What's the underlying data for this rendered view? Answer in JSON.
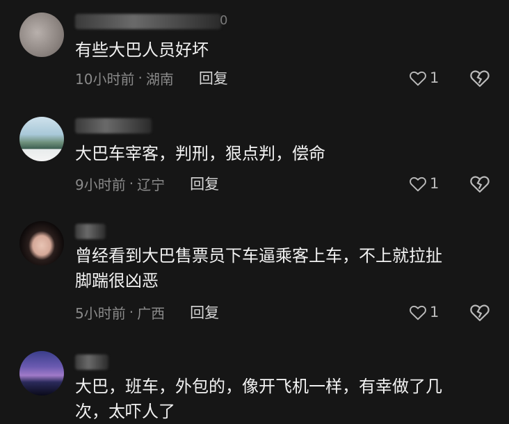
{
  "comments": [
    {
      "name_tail": "0",
      "text": "有些大巴人员好坏",
      "time": "10小时前",
      "separator": "·",
      "location": "湖南",
      "reply_label": "回复",
      "likes": "1"
    },
    {
      "name_tail": "",
      "text": "大巴车宰客，判刑，狠点判，偿命",
      "time": "9小时前",
      "separator": "·",
      "location": "辽宁",
      "reply_label": "回复",
      "likes": "1"
    },
    {
      "name_tail": "",
      "text": "曾经看到大巴售票员下车逼乘客上车，不上就拉扯\n脚踹很凶恶",
      "time": "5小时前",
      "separator": "·",
      "location": "广西",
      "reply_label": "回复",
      "likes": "1"
    },
    {
      "name_tail": "",
      "text": "大巴，班车，外包的，像开飞机一样，有幸做了几\n次，太吓人了"
    }
  ],
  "colors": {
    "background": "#161616",
    "text": "#f2f2f2",
    "meta": "#8a8a8a",
    "reply": "#d6d6d6"
  }
}
